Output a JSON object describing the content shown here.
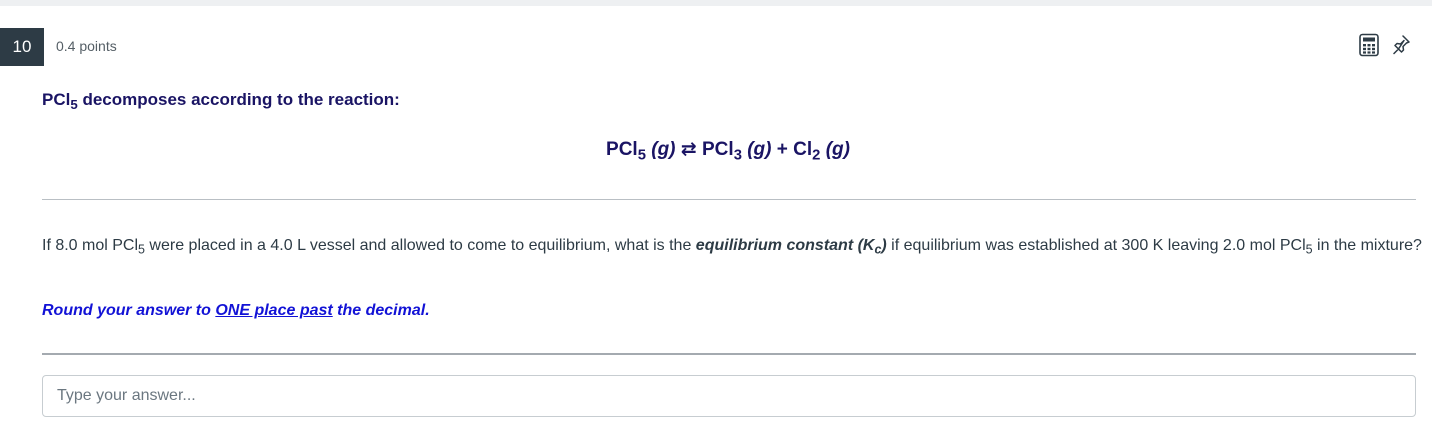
{
  "question": {
    "number": "10",
    "points": "0.4 points",
    "intro_prefix": "PCl",
    "intro_sub": "5",
    "intro_suffix": " decomposes according to the reaction:",
    "equation": {
      "reactant": "PCl",
      "reactant_sub": "5",
      "reactant_state": "(g)",
      "arrow": "⇄",
      "product1": "PCl",
      "product1_sub": "3",
      "product1_state": "(g)",
      "plus": "+",
      "product2": "Cl",
      "product2_sub": "2",
      "product2_state": "(g)"
    },
    "body": {
      "part1": "If 8.0 mol PCl",
      "sub1": "5",
      "part2": " were placed in a 4.0 L vessel and allowed to come to equilibrium, what is the ",
      "emph": "equilibrium constant (K",
      "emph_sub": "c",
      "emph_end": ")",
      "part3": " if equilibrium was established at 300 K leaving 2.0 mol PCl",
      "sub2": "5",
      "part4": " in the mixture?"
    },
    "instruction": {
      "prefix": "Round your answer to ",
      "underlined": "ONE place past",
      "suffix": " the decimal."
    }
  },
  "answer": {
    "placeholder": "Type your answer...",
    "value": ""
  },
  "toolbar": {
    "calculator_icon": "calculator-icon",
    "pin_icon": "pin-icon"
  }
}
